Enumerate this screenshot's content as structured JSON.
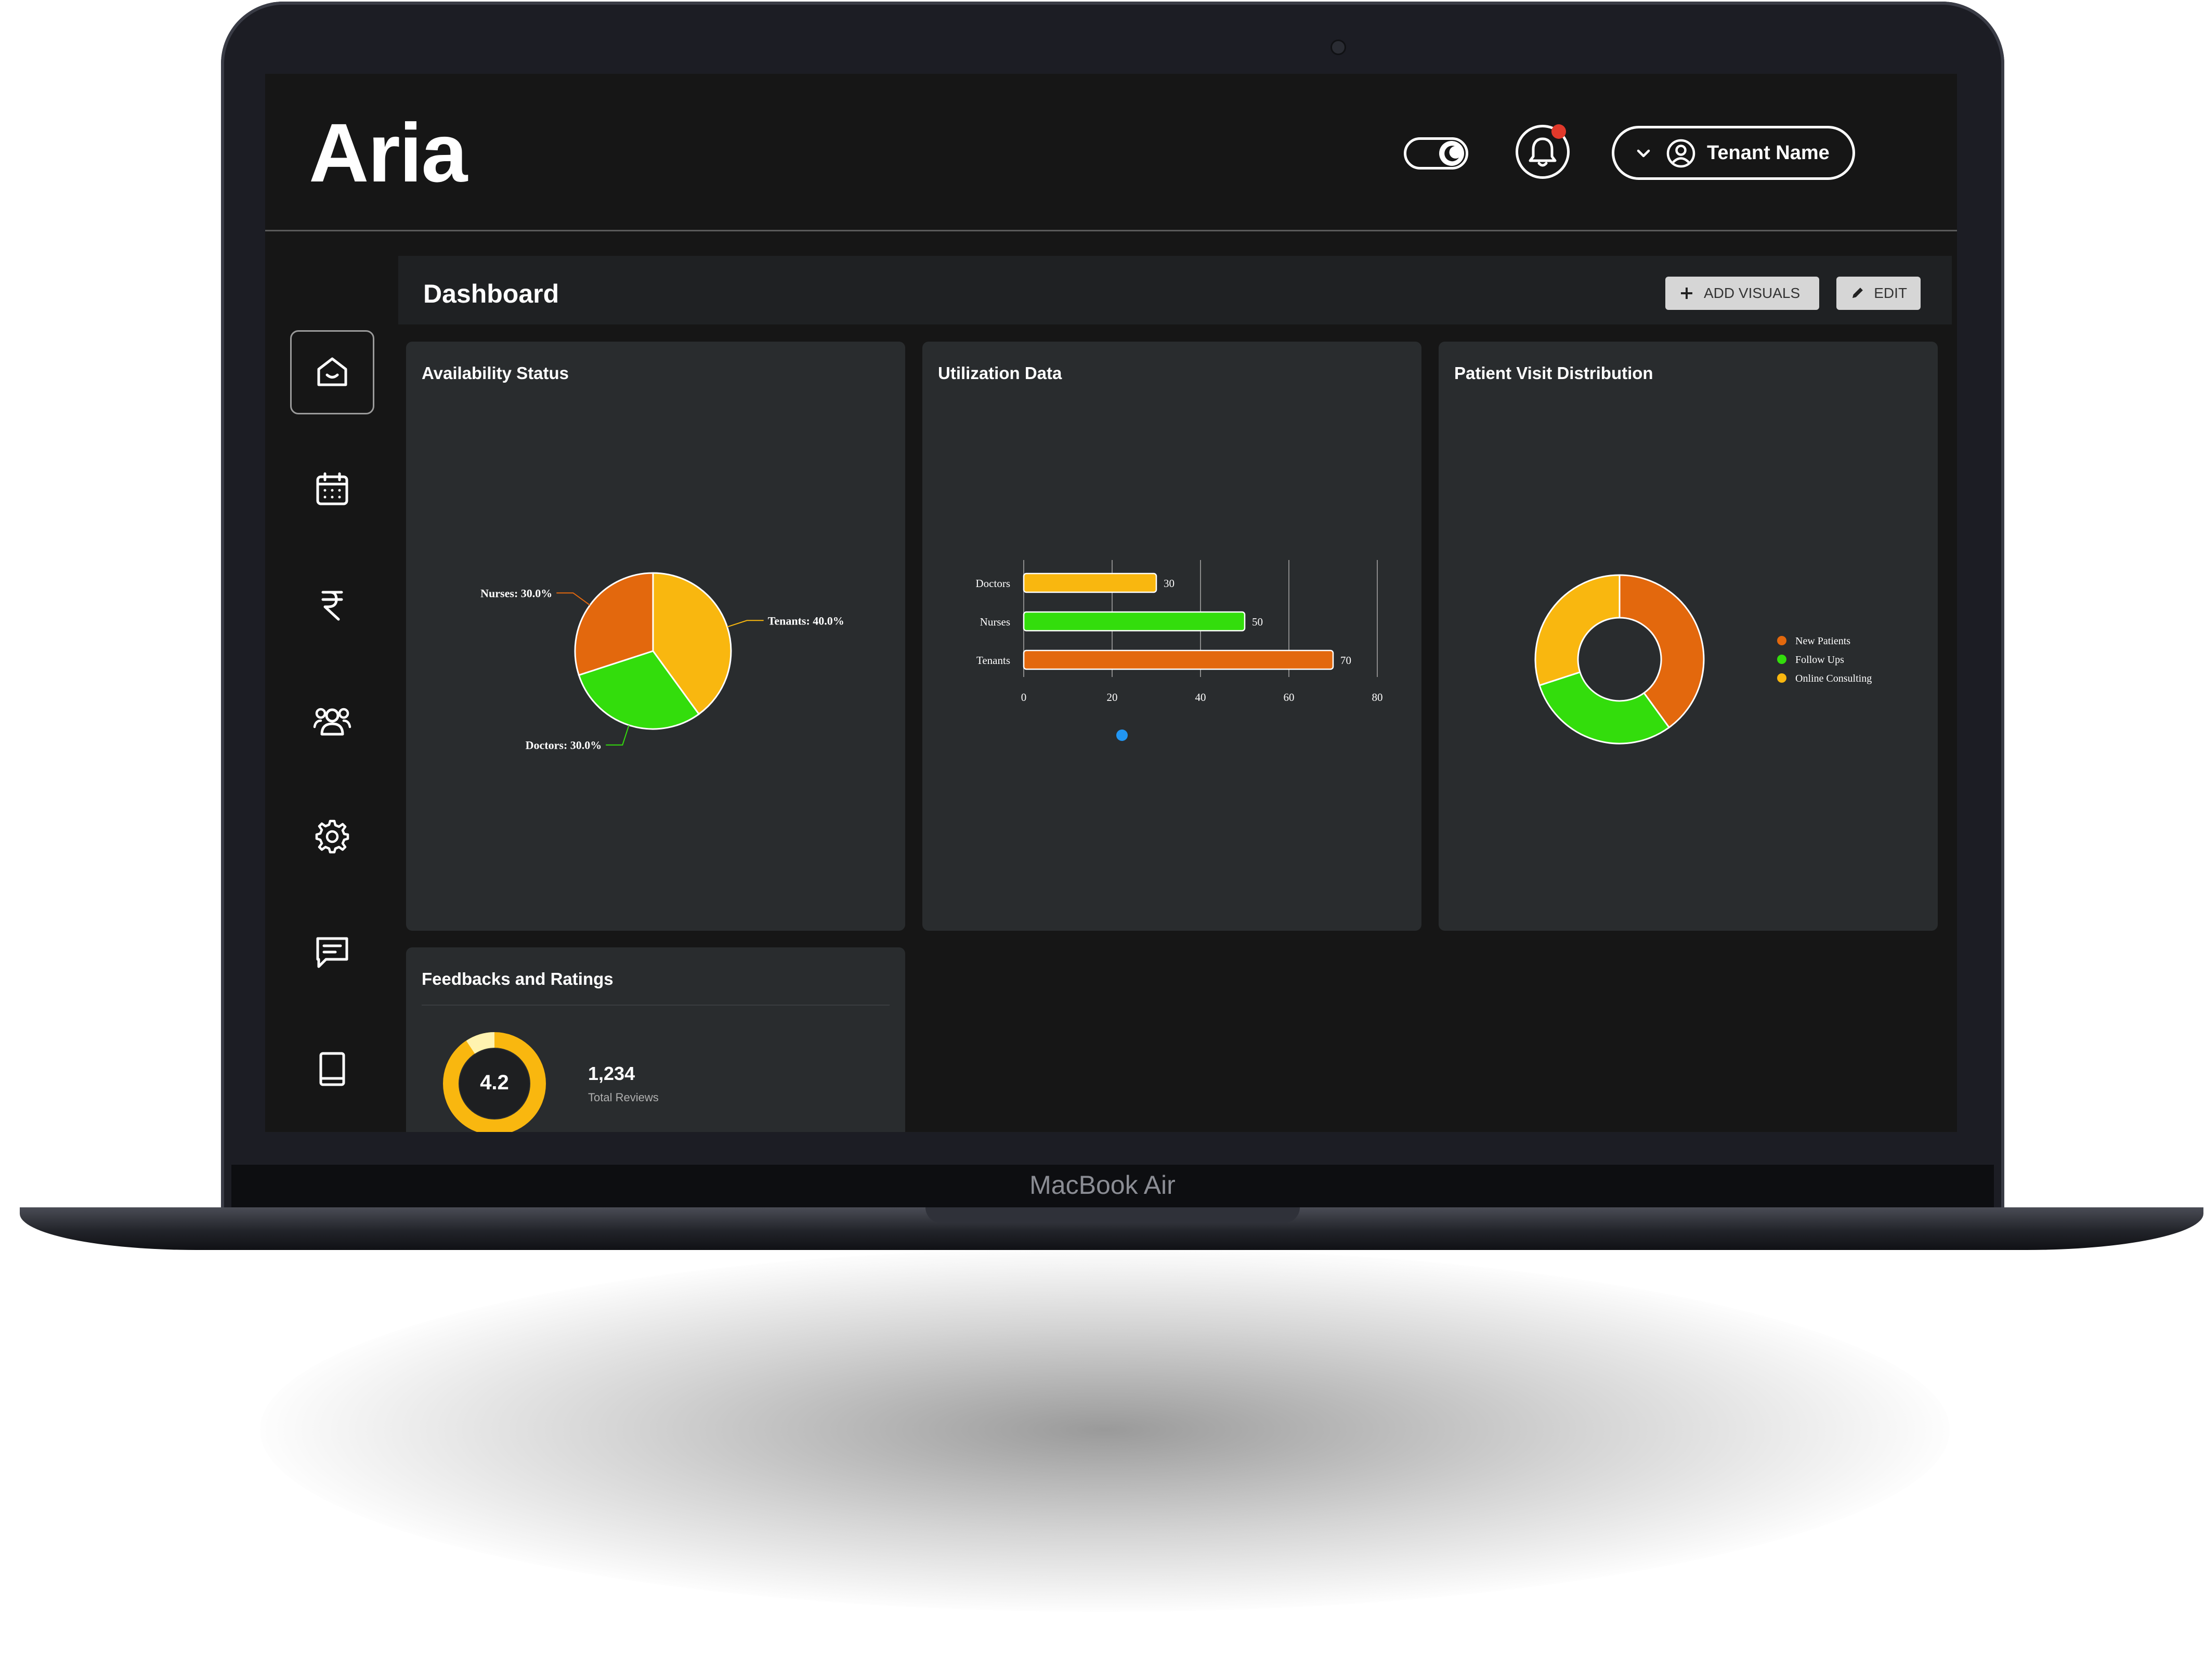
{
  "device": {
    "model_label": "MacBook Air"
  },
  "app": {
    "name": "Aria"
  },
  "header": {
    "user_name": "Tenant Name"
  },
  "sidebar": {
    "items": [
      {
        "id": "home",
        "icon": "home-icon",
        "active": true
      },
      {
        "id": "calendar",
        "icon": "calendar-icon"
      },
      {
        "id": "billing",
        "icon": "rupee-icon"
      },
      {
        "id": "users",
        "icon": "users-icon"
      },
      {
        "id": "settings",
        "icon": "gear-icon"
      },
      {
        "id": "messages",
        "icon": "message-icon"
      },
      {
        "id": "docs",
        "icon": "book-icon"
      }
    ]
  },
  "dashboard": {
    "title": "Dashboard",
    "add_visuals_label": "ADD VISUALS",
    "edit_label": "EDIT"
  },
  "cards": {
    "availability": {
      "title": "Availability Status"
    },
    "utilization": {
      "title": "Utilization Data"
    },
    "patient_visit": {
      "title": "Patient Visit Distribution"
    },
    "feedback": {
      "title": "Feedbacks and Ratings",
      "rating": "4.2",
      "total": "1,234",
      "total_label": "Total Reviews"
    }
  },
  "chart_data": [
    {
      "type": "pie",
      "title": "Availability Status",
      "labels": [
        "Tenants",
        "Doctors",
        "Nurses"
      ],
      "values": [
        40.0,
        30.0,
        30.0
      ],
      "slice_labels": [
        "Tenants: 40.0%",
        "Doctors: 30.0%",
        "Nurses: 30.0%"
      ],
      "colors": [
        "#f9b70f",
        "#33dd0c",
        "#e3680d"
      ]
    },
    {
      "type": "bar",
      "orientation": "horizontal",
      "title": "Utilization Data",
      "categories": [
        "Doctors",
        "Nurses",
        "Tenants"
      ],
      "values": [
        30,
        50,
        70
      ],
      "colors": [
        "#f9b70f",
        "#33dd0c",
        "#e3680d"
      ],
      "xlim": [
        0,
        80
      ],
      "xticks": [
        "0",
        "20",
        "40",
        "60",
        "80"
      ],
      "legend_marker_color": "#2196f3"
    },
    {
      "type": "pie",
      "donut": true,
      "title": "Patient Visit Distribution",
      "labels": [
        "New Patients",
        "Follow Ups",
        "Online Consulting"
      ],
      "values": [
        40,
        30,
        30
      ],
      "colors": [
        "#e3680d",
        "#33dd0c",
        "#f9b70f"
      ],
      "legend_position": "right"
    }
  ]
}
